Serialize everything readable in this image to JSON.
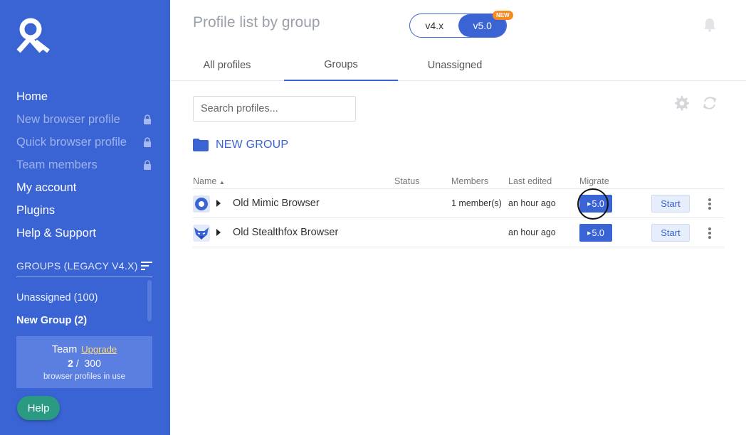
{
  "sidebar": {
    "nav": [
      {
        "label": "Home",
        "locked": false
      },
      {
        "label": "New browser profile",
        "locked": true
      },
      {
        "label": "Quick browser profile",
        "locked": true
      },
      {
        "label": "Team members",
        "locked": true
      },
      {
        "label": "My account",
        "locked": false
      },
      {
        "label": "Plugins",
        "locked": false
      },
      {
        "label": "Help & Support",
        "locked": false
      }
    ],
    "groups_header": "GROUPS (LEGACY V4.X)",
    "groups": [
      {
        "label": "Unassigned (100)",
        "active": false
      },
      {
        "label": "New Group (2)",
        "active": true
      }
    ],
    "plan": {
      "name": "Team",
      "upgrade_label": "Upgrade",
      "used": "2",
      "separator": "/",
      "total": "300",
      "caption": "browser profiles in use"
    },
    "help_label": "Help"
  },
  "header": {
    "title": "Profile list by group",
    "version_options": [
      "v4.x",
      "v5.0"
    ],
    "version_selected": "v5.0",
    "new_badge": "NEW"
  },
  "tabs": [
    {
      "label": "All profiles",
      "active": false
    },
    {
      "label": "Groups",
      "active": true
    },
    {
      "label": "Unassigned",
      "active": false
    }
  ],
  "search": {
    "placeholder": "Search profiles..."
  },
  "group": {
    "name": "NEW GROUP"
  },
  "table": {
    "columns": {
      "name": "Name",
      "status": "Status",
      "members": "Members",
      "last_edited": "Last edited",
      "migrate": "Migrate"
    },
    "rows": [
      {
        "name": "Old Mimic Browser",
        "browser_icon": "mimic-icon",
        "status": "",
        "members": "1 member(s)",
        "last_edited": "an hour ago",
        "migrate_label": "5.0",
        "start_label": "Start"
      },
      {
        "name": "Old Stealthfox Browser",
        "browser_icon": "stealthfox-icon",
        "status": "",
        "members": "",
        "last_edited": "an hour ago",
        "migrate_label": "5.0",
        "start_label": "Start"
      }
    ]
  },
  "colors": {
    "brand": "#3a63d4",
    "help": "#2b9a83",
    "badge": "#f58a21"
  }
}
